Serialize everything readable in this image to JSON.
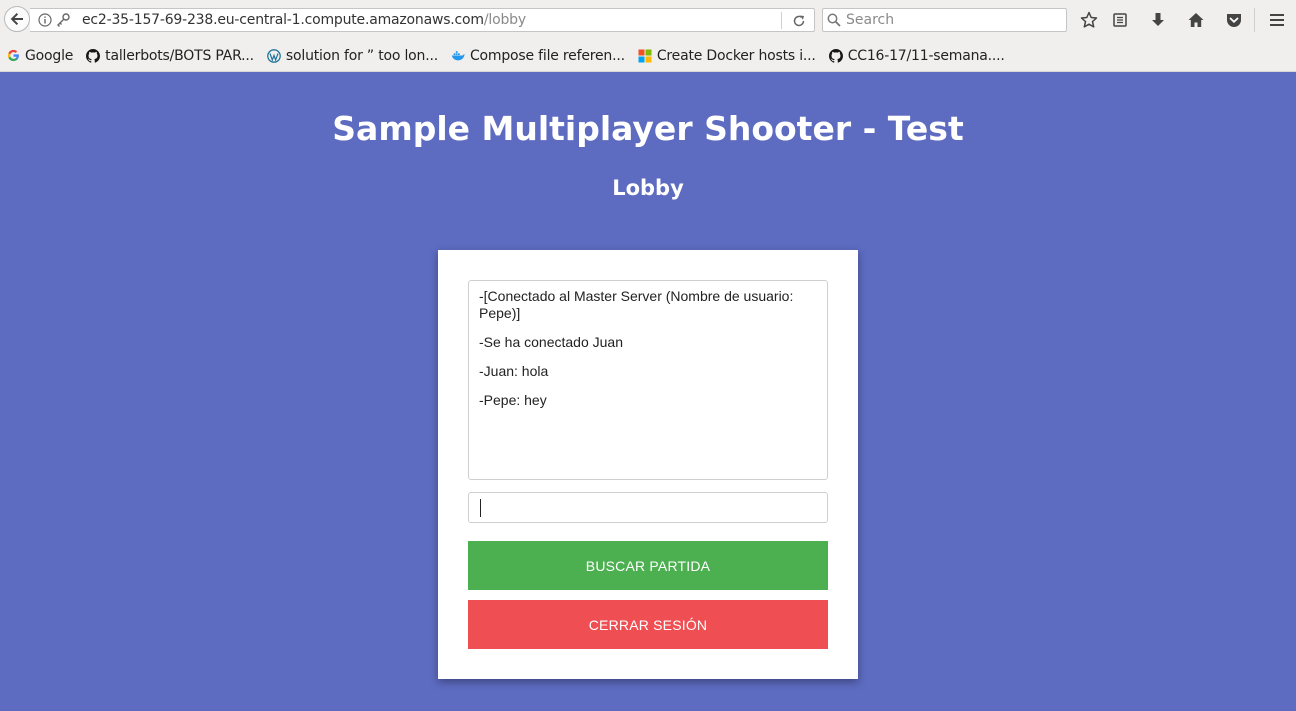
{
  "browser": {
    "url_host": "ec2-35-157-69-238.eu-central-1.compute.amazonaws.com",
    "url_path": "/lobby",
    "search_placeholder": "Search",
    "bookmarks": [
      {
        "icon": "google-icon",
        "label": "Google"
      },
      {
        "icon": "github-icon",
        "label": "tallerbots/BOTS PAR..."
      },
      {
        "icon": "wordpress-icon",
        "label": "solution for ” too lon..."
      },
      {
        "icon": "docker-icon",
        "label": "Compose file referen..."
      },
      {
        "icon": "microsoft-icon",
        "label": "Create Docker hosts i..."
      },
      {
        "icon": "github-icon",
        "label": "CC16-17/11-semana...."
      }
    ]
  },
  "page": {
    "title": "Sample Multiplayer Shooter - Test",
    "subtitle": "Lobby",
    "chat_messages": [
      "-[Conectado al Master Server (Nombre de usuario: Pepe)]",
      "-Se ha conectado Juan",
      "-Juan: hola",
      "-Pepe: hey"
    ],
    "chat_input_value": "",
    "buttons": {
      "find_match": "BUSCAR PARTIDA",
      "logout": "CERRAR SESIÓN"
    }
  },
  "colors": {
    "background": "#5d6bc1",
    "find_match_button": "#4caf50",
    "logout_button": "#ef4f52"
  }
}
